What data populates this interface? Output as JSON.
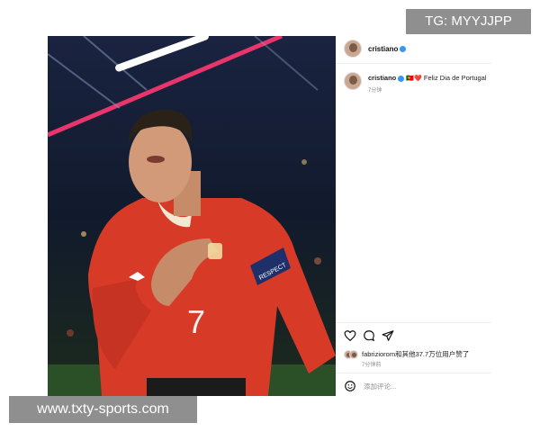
{
  "overlay": {
    "tg_label": "TG: MYYJJPP",
    "site_watermark": "www.txty-sports.com"
  },
  "post": {
    "header": {
      "username": "cristiano"
    },
    "caption": {
      "username": "cristiano",
      "emoji": "🇵🇹❤️",
      "text": "Feliz Dia de Portugal",
      "time": "7分钟"
    },
    "photo": {
      "jersey_number": "7",
      "armband_text": "RESPECT",
      "jersey_color": "#e2432e"
    },
    "actions": {
      "like_icon": "heart-icon",
      "comment_icon": "comment-icon",
      "share_icon": "share-icon"
    },
    "likes": {
      "text": "fabriziorom和其他37.7万位用户赞了",
      "time": "7分钟前"
    },
    "comment": {
      "placeholder": "添加评论..."
    }
  },
  "colors": {
    "verified": "#3897f0",
    "watermark_bg": "#8f8f8f",
    "secondary_text": "#8e8e8e"
  }
}
